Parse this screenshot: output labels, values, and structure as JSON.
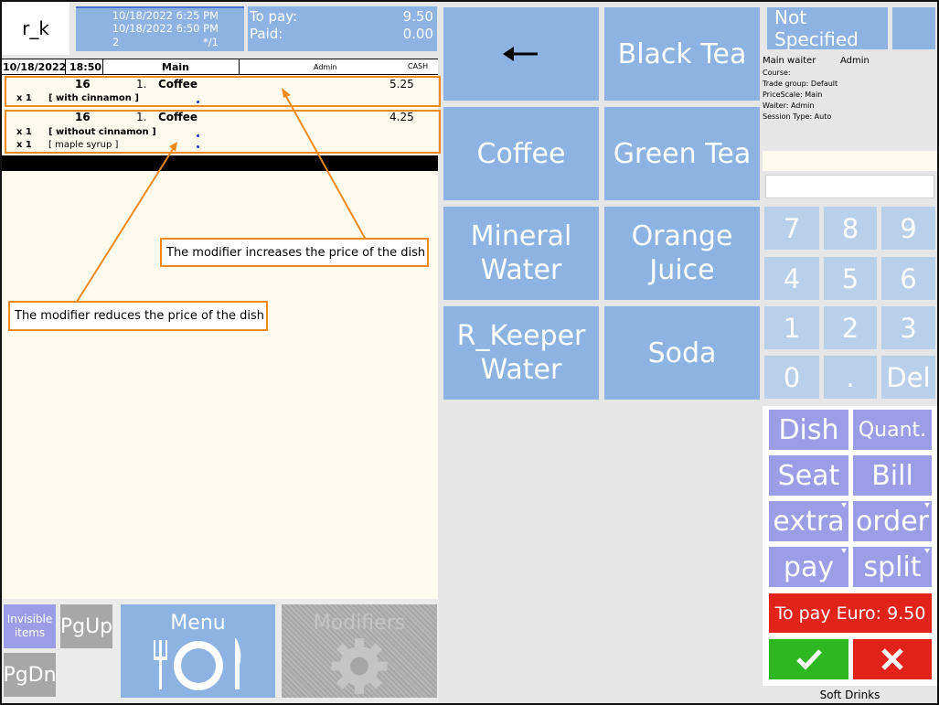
{
  "logo": "r_k",
  "order_info": {
    "opened": "10/18/2022 6:25 PM",
    "printed": "10/18/2022 6:50 PM",
    "guests": "2",
    "table": "*/1"
  },
  "payment": {
    "to_pay_label": "To pay:",
    "to_pay": "9.50",
    "paid_label": "Paid:",
    "paid": "0.00"
  },
  "receipt_header": {
    "date": "10/18/2022",
    "time": "18:50",
    "course": "Main",
    "waiter": "Admin",
    "payment_type": "CASH"
  },
  "order_lines": [
    {
      "code": "16",
      "seat": "1.",
      "name": "Coffee",
      "price": "5.25",
      "modifiers": [
        {
          "qty": "x 1",
          "name": "[ with cinnamon ]"
        }
      ]
    },
    {
      "code": "16",
      "seat": "1.",
      "name": "Coffee",
      "price": "4.25",
      "modifiers": [
        {
          "qty": "x 1",
          "name": "[ without cinnamon ]"
        },
        {
          "qty": "x 1",
          "name": "[ maple syrup ]"
        }
      ]
    }
  ],
  "callouts": {
    "increase": "The modifier increases the price of the dish",
    "reduce": "The modifier reduces the price of the dish"
  },
  "bottom": {
    "invisible": "Invisible items",
    "pgup": "PgUp",
    "pgdn": "PgDn",
    "menu": "Menu",
    "modifiers": "Modifiers"
  },
  "products": {
    "back": "←",
    "items": [
      "Black Tea",
      "Coffee",
      "Green Tea",
      "Mineral Water",
      "Orange Juice",
      "R_Keeper Water",
      "Soda"
    ]
  },
  "right_info": {
    "not_specified": "Not Specified",
    "main_waiter_label": "Main waiter",
    "main_waiter": "Admin",
    "course": "Course:",
    "trade_group": "Trade group: Default",
    "price_scale": "PriceScale: Main",
    "waiter": "Waiter: Admin",
    "session_type": "Session Type: Auto"
  },
  "numpad": [
    "7",
    "8",
    "9",
    "4",
    "5",
    "6",
    "1",
    "2",
    "3",
    "0",
    ".",
    "Del"
  ],
  "functions": [
    "Dish",
    "Quant.",
    "Seat",
    "Bill",
    "extra",
    "order",
    "pay",
    "split"
  ],
  "to_pay_button": "To pay Euro: 9.50",
  "actions": {
    "ok": "✔",
    "cancel": "✖"
  },
  "category": "Soft Drinks",
  "colors": {
    "blue": "#8db3e2",
    "light_blue": "#b8d0ea",
    "purple": "#9b9ee6",
    "red": "#e2231a",
    "green": "#2db821",
    "orange": "#f08a1c"
  }
}
